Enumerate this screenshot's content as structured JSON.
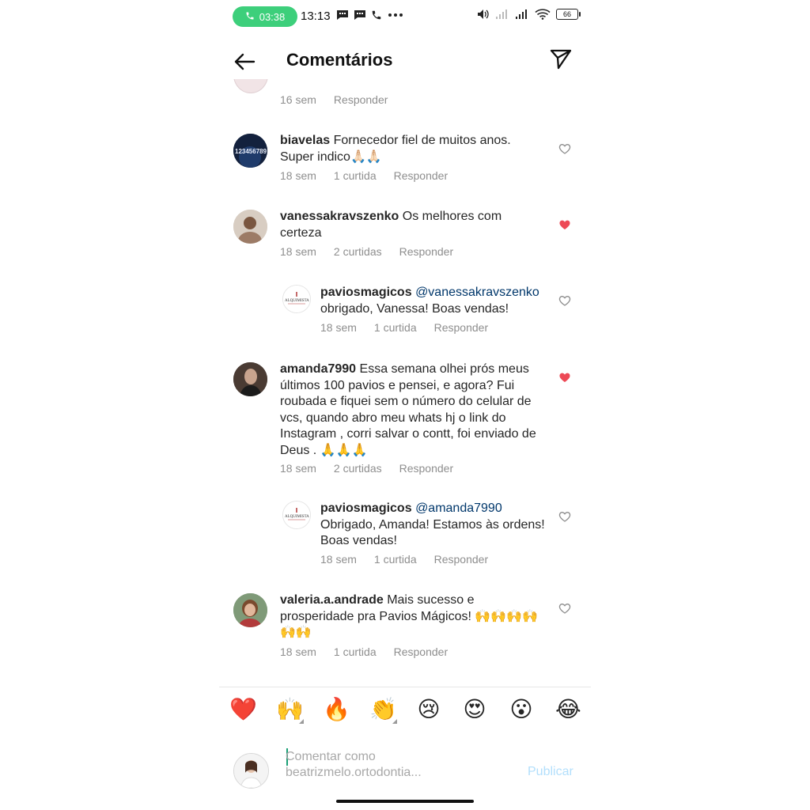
{
  "status_bar": {
    "call_timer": "03:38",
    "clock": "13:13",
    "battery": "66"
  },
  "header": {
    "title": "Comentários"
  },
  "top_partial_comment": {
    "time": "16 sem",
    "reply": "Responder"
  },
  "comments": [
    {
      "username": "biavelas",
      "text": "Fornecedor fiel de muitos anos. Super indico🙏🏻🙏🏻",
      "time": "18 sem",
      "likes": "1 curtida",
      "reply": "Responder",
      "liked": false
    },
    {
      "username": "vanessakravszenko",
      "text": "Os melhores com certeza",
      "time": "18 sem",
      "likes": "2 curtidas",
      "reply": "Responder",
      "liked": true
    },
    {
      "username": "paviosmagicos",
      "mention": "@vanessakravszenko",
      "text": "obrigado, Vanessa! Boas vendas!",
      "time": "18 sem",
      "likes": "1 curtida",
      "reply": "Responder",
      "liked": false
    },
    {
      "username": "amanda7990",
      "text": "Essa semana olhei prós meus últimos 100 pavios e pensei, e agora? Fui roubada e fiquei sem o número do celular de vcs, quando abro meu whats hj o link do Instagram , corri salvar o contt, foi enviado de Deus . 🙏🙏🙏",
      "time": "18 sem",
      "likes": "2 curtidas",
      "reply": "Responder",
      "liked": true
    },
    {
      "username": "paviosmagicos",
      "mention": "@amanda7990",
      "text": "Obrigado, Amanda! Estamos às ordens!  Boas vendas!",
      "time": "18 sem",
      "likes": "1 curtida",
      "reply": "Responder",
      "liked": false
    },
    {
      "username": "valeria.a.andrade",
      "text": "Mais sucesso e prosperidade pra Pavios Mágicos! 🙌🙌🙌🙌🙌🙌",
      "time": "18 sem",
      "likes": "1 curtida",
      "reply": "Responder",
      "liked": false
    }
  ],
  "avatar_texts": {
    "biavelas": "123456789",
    "paviosmagicos": "ALQUIMISTA"
  },
  "emoji_bar": [
    "❤️",
    "🙌",
    "🔥",
    "👏",
    "😢",
    "😍",
    "😮",
    "😂"
  ],
  "composer": {
    "placeholder": "Comentar como beatrizmelo.ortodontia...",
    "publish_label": "Publicar"
  },
  "colors": {
    "call_pill": "#3dcf7b",
    "liked_heart": "#ed4956",
    "mention": "#00376b",
    "meta": "#8e8e8e",
    "publish_disabled": "#b2dffc"
  }
}
